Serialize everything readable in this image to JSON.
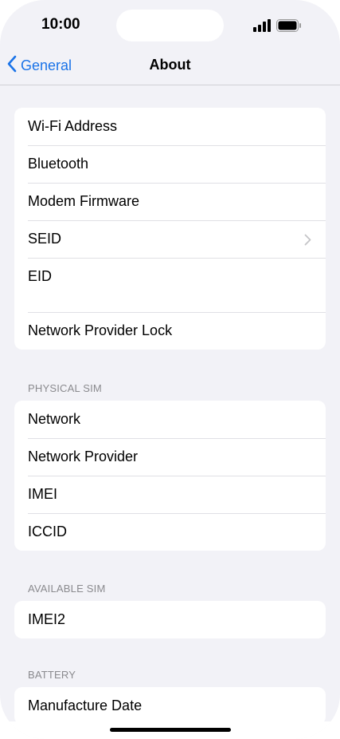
{
  "status_bar": {
    "time": "10:00"
  },
  "nav": {
    "back_label": "General",
    "title": "About"
  },
  "groups": [
    {
      "rows": [
        {
          "label": "Wi-Fi Address"
        },
        {
          "label": "Bluetooth"
        },
        {
          "label": "Modem Firmware"
        },
        {
          "label": "SEID"
        },
        {
          "label": "EID"
        },
        {
          "label": "Network Provider Lock"
        }
      ]
    },
    {
      "header": "PHYSICAL SIM",
      "rows": [
        {
          "label": "Network"
        },
        {
          "label": "Network Provider"
        },
        {
          "label": "IMEI"
        },
        {
          "label": "ICCID"
        }
      ]
    },
    {
      "header": "AVAILABLE SIM",
      "rows": [
        {
          "label": "IMEI2"
        }
      ]
    },
    {
      "header": "BATTERY",
      "rows": [
        {
          "label": "Manufacture Date"
        }
      ]
    }
  ],
  "colors": {
    "accent": "#1a73e8",
    "background": "#f2f2f7"
  }
}
